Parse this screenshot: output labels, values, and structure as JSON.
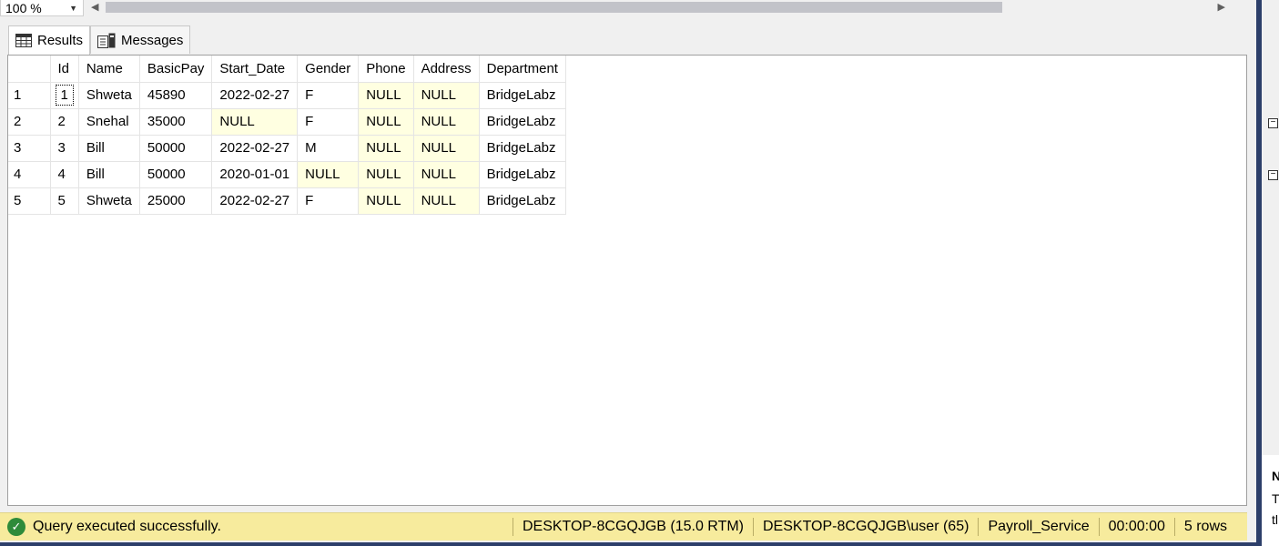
{
  "zoom": {
    "value": "100 %"
  },
  "tabs": [
    {
      "label": "Results",
      "icon": "grid-icon"
    },
    {
      "label": "Messages",
      "icon": "messages-icon"
    }
  ],
  "grid": {
    "columns": [
      "",
      "Id",
      "Name",
      "BasicPay",
      "Start_Date",
      "Gender",
      "Phone",
      "Address",
      "Department"
    ],
    "rows": [
      [
        "1",
        "1",
        "Shweta",
        "45890",
        "2022-02-27",
        "F",
        "NULL",
        "NULL",
        "BridgeLabz"
      ],
      [
        "2",
        "2",
        "Snehal",
        "35000",
        "NULL",
        "F",
        "NULL",
        "NULL",
        "BridgeLabz"
      ],
      [
        "3",
        "3",
        "Bill",
        "50000",
        "2022-02-27",
        "M",
        "NULL",
        "NULL",
        "BridgeLabz"
      ],
      [
        "4",
        "4",
        "Bill",
        "50000",
        "2020-01-01",
        "NULL",
        "NULL",
        "NULL",
        "BridgeLabz"
      ],
      [
        "5",
        "5",
        "Shweta",
        "25000",
        "2022-02-27",
        "F",
        "NULL",
        "NULL",
        "BridgeLabz"
      ]
    ]
  },
  "status": {
    "message": "Query executed successfully.",
    "server": "DESKTOP-8CGQJGB (15.0 RTM)",
    "user": "DESKTOP-8CGQJGB\\user (65)",
    "database": "Payroll_Service",
    "elapsed": "00:00:00",
    "rows": "5 rows",
    "color": "#f7eb9d"
  },
  "right_panel": {
    "text_top": "N",
    "text_mid": "T",
    "text_bottom": "tl"
  }
}
